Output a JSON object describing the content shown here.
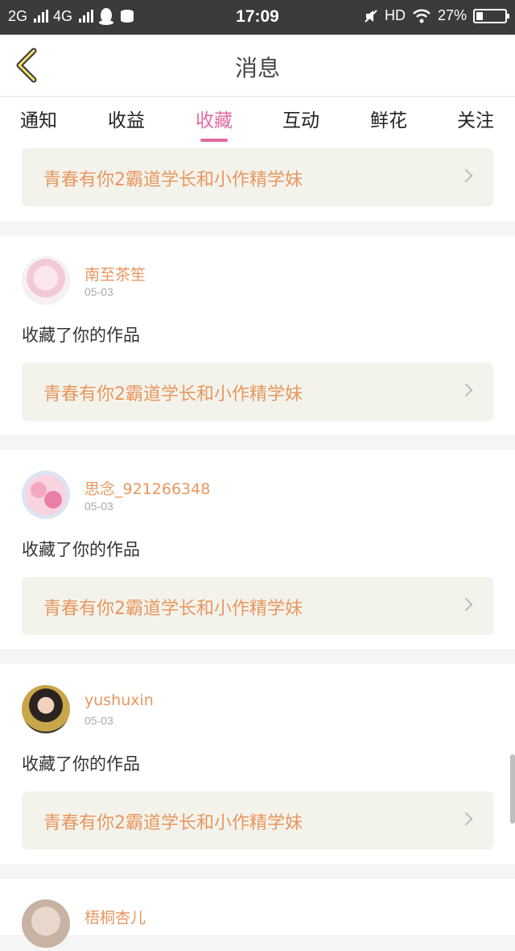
{
  "status": {
    "left": "2G 4G",
    "net1": "2G",
    "net2": "4G",
    "time": "17:09",
    "hd": "HD",
    "battery": "27%"
  },
  "header": {
    "title": "消息"
  },
  "tabs": [
    {
      "label": "通知"
    },
    {
      "label": "收益"
    },
    {
      "label": "收藏"
    },
    {
      "label": "互动"
    },
    {
      "label": "鲜花"
    },
    {
      "label": "关注"
    }
  ],
  "active_tab": "收藏",
  "colors": {
    "accent": "#e26ba0",
    "name": "#e8975e",
    "work_bg": "#f3f3ec"
  },
  "feed": {
    "first_work": "青春有你2霸道学长和小作精学妹",
    "items": [
      {
        "name": "南至茶笙",
        "date": "05-03",
        "action": "收藏了你的作品",
        "work": "青春有你2霸道学长和小作精学妹"
      },
      {
        "name": "思念_921266348",
        "date": "05-03",
        "action": "收藏了你的作品",
        "work": "青春有你2霸道学长和小作精学妹"
      },
      {
        "name": "yushuxin",
        "date": "05-03",
        "action": "收藏了你的作品",
        "work": "青春有你2霸道学长和小作精学妹"
      },
      {
        "name": "梧桐杏儿"
      }
    ]
  }
}
